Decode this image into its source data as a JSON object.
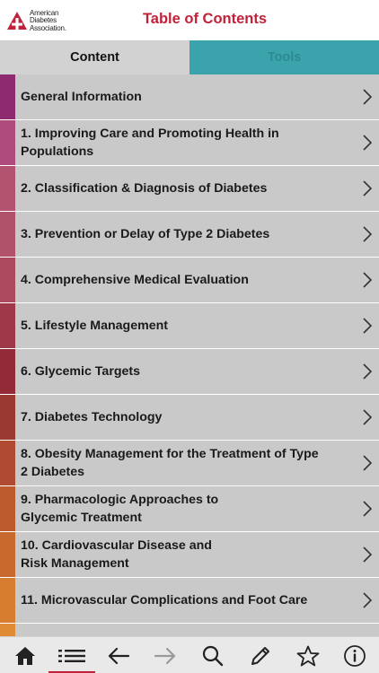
{
  "header": {
    "logo_lines": [
      "American",
      "Diabetes",
      "Association."
    ],
    "title": "Table of Contents"
  },
  "tabs": [
    {
      "label": "Content",
      "selected": true
    },
    {
      "label": "Tools",
      "selected": false
    }
  ],
  "colors": {
    "brand": "#c0223b",
    "tools_tab": "#3aa3ac",
    "row_bg": "#c9c9c9"
  },
  "toc": [
    {
      "label": "General Information",
      "color": "#8e2a6e"
    },
    {
      "label": "1. Improving Care and Promoting Health in\nPopulations",
      "color": "#b04c7b"
    },
    {
      "label": "2. Classification & Diagnosis of Diabetes",
      "color": "#b3536f"
    },
    {
      "label": "3. Prevention or Delay of Type 2 Diabetes",
      "color": "#b05269"
    },
    {
      "label": "4. Comprehensive Medical Evaluation",
      "color": "#ab4a5f"
    },
    {
      "label": "5. Lifestyle Management",
      "color": "#9f3848"
    },
    {
      "label": "6. Glycemic Targets",
      "color": "#922a38"
    },
    {
      "label": "7. Diabetes Technology",
      "color": "#9a3832"
    },
    {
      "label": "8. Obesity Management for the Treatment of Type\n2 Diabetes",
      "color": "#b04b33"
    },
    {
      "label": "9. Pharmacologic Approaches to\nGlycemic Treatment",
      "color": "#bd5a2e"
    },
    {
      "label": "10. Cardiovascular Disease and\nRisk Management",
      "color": "#c8692d"
    },
    {
      "label": "11. Microvascular Complications and Foot Care",
      "color": "#d77d2f"
    },
    {
      "label": "",
      "color": "#de8b33"
    }
  ],
  "toolbar": [
    {
      "icon": "home-icon",
      "active": false
    },
    {
      "icon": "list-icon",
      "active": true
    },
    {
      "icon": "back-arrow-icon",
      "active": false
    },
    {
      "icon": "forward-arrow-icon",
      "active": false,
      "disabled": true
    },
    {
      "icon": "search-icon",
      "active": false
    },
    {
      "icon": "pencil-icon",
      "active": false
    },
    {
      "icon": "star-icon",
      "active": false
    },
    {
      "icon": "info-icon",
      "active": false
    }
  ]
}
